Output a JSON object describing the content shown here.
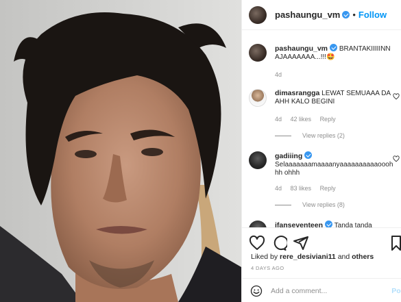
{
  "post": {
    "username": "pashaungu_vm",
    "follow_label": "Follow",
    "separator": "•"
  },
  "caption": {
    "username": "pashaungu_vm",
    "text": "BRANTAKIIIIINN AJAAAAAAA...!!!🤩",
    "age": "4d"
  },
  "comments": [
    {
      "username": "dimasrangga",
      "text": "LEWAT SEMUAAA DAAHH KALO BEGINI",
      "age": "4d",
      "likes": "42 likes",
      "reply_label": "Reply",
      "view_replies": "View replies (2)"
    },
    {
      "username": "gadiiing",
      "text": "Selaaaaaaamaaaanyaaaaaaaaaaooohhh ohhh",
      "age": "4d",
      "likes": "83 likes",
      "reply_label": "Reply",
      "view_replies": "View replies (8)"
    },
    {
      "username": "ifanseventeen",
      "text": "Tanda tanda"
    }
  ],
  "actions": {
    "icons": [
      "heart-icon",
      "comment-icon",
      "share-icon",
      "bookmark-icon"
    ],
    "liked_by_prefix": "Liked by",
    "liked_by_user": "rere_desiviani11",
    "liked_by_suffix": "and",
    "liked_by_others": "others",
    "date": "4 DAYS AGO"
  },
  "add_comment": {
    "placeholder": "Add a comment...",
    "post_label": "Post"
  },
  "colors": {
    "accent": "#0095f6",
    "verified": "#3897f0",
    "muted": "#8e8e8e",
    "text": "#262626"
  }
}
